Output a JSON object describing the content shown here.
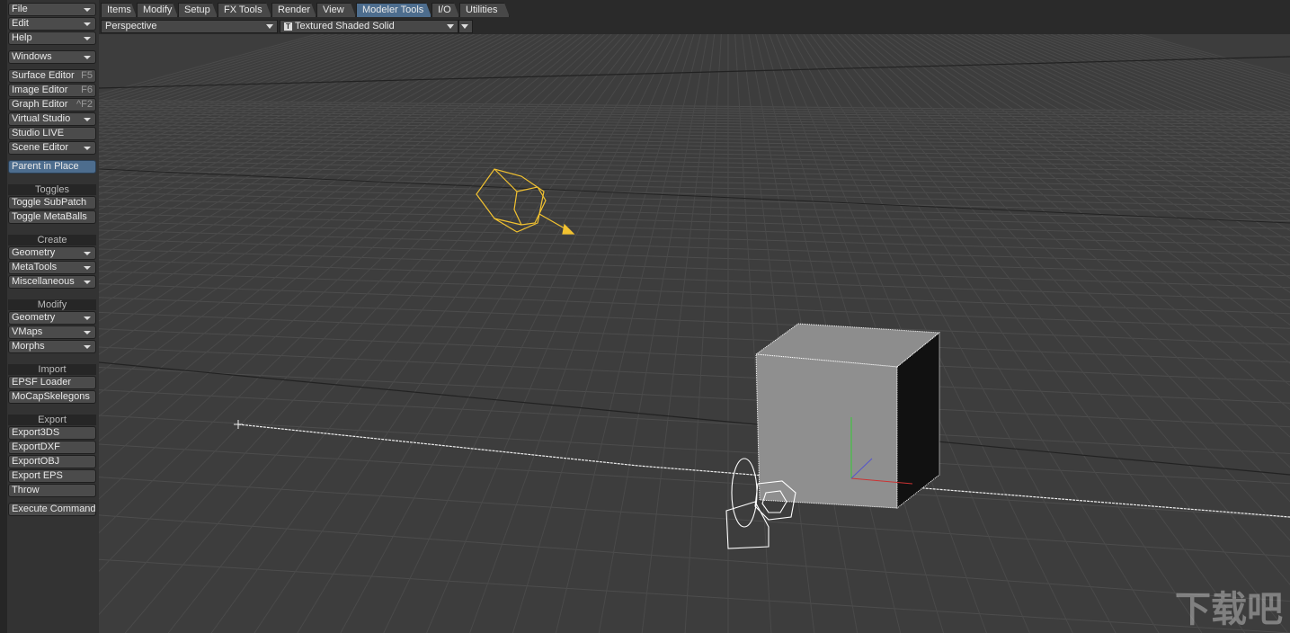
{
  "sidebar": {
    "menus": [
      {
        "label": "File"
      },
      {
        "label": "Edit"
      },
      {
        "label": "Help"
      },
      {
        "label": "Windows"
      }
    ],
    "windows": [
      {
        "label": "Surface Editor",
        "key": "F5"
      },
      {
        "label": "Image Editor",
        "key": "F6"
      },
      {
        "label": "Graph Editor",
        "key": "^F2"
      },
      {
        "label": "Virtual Studio",
        "key": ""
      },
      {
        "label": "Studio LIVE",
        "key": ""
      },
      {
        "label": "Scene Editor",
        "key": ""
      }
    ],
    "parent_in_place": "Parent in Place",
    "toggles": {
      "header": "Toggles",
      "items": [
        "Toggle SubPatch",
        "Toggle MetaBalls"
      ]
    },
    "create": {
      "header": "Create",
      "items": [
        "Geometry",
        "MetaTools",
        "Miscellaneous"
      ]
    },
    "modify": {
      "header": "Modify",
      "items": [
        "Geometry",
        "VMaps",
        "Morphs"
      ]
    },
    "import": {
      "header": "Import",
      "items": [
        "EPSF Loader",
        "MoCapSkelegons"
      ]
    },
    "export": {
      "header": "Export",
      "items": [
        "Export3DS",
        "ExportDXF",
        "ExportOBJ",
        "Export EPS",
        "Throw"
      ]
    },
    "execute": "Execute Command"
  },
  "tabs": [
    "Items",
    "Modify",
    "Setup",
    "FX Tools",
    "Render",
    "View",
    "Modeler Tools",
    "I/O",
    "Utilities"
  ],
  "active_tab": "Modeler Tools",
  "viewport": {
    "view": "Perspective",
    "shading": "Textured Shaded Solid",
    "shading_icon": "T"
  },
  "watermark": "下载吧",
  "colors": {
    "accent": "#4d6d8e",
    "viewport_bg": "#3d3d3d",
    "selected_object": "#e8b830"
  }
}
